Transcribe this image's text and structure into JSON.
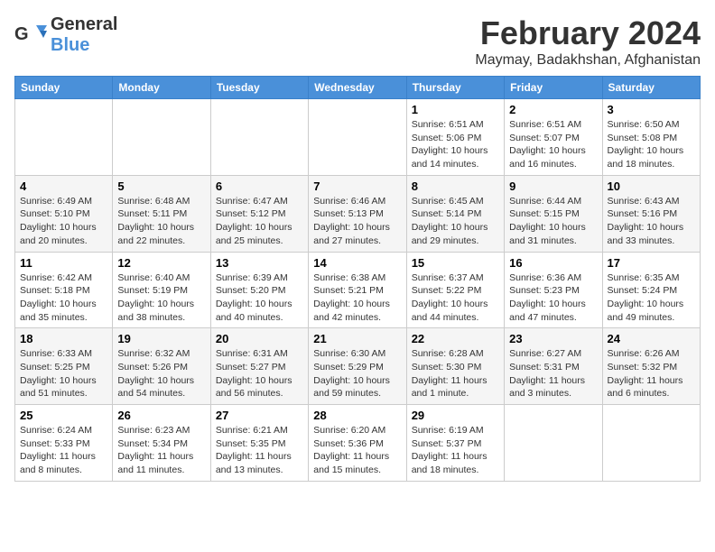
{
  "logo": {
    "general": "General",
    "blue": "Blue"
  },
  "header": {
    "month_year": "February 2024",
    "location": "Maymay, Badakhshan, Afghanistan"
  },
  "days_of_week": [
    "Sunday",
    "Monday",
    "Tuesday",
    "Wednesday",
    "Thursday",
    "Friday",
    "Saturday"
  ],
  "weeks": [
    [
      {
        "day": "",
        "info": ""
      },
      {
        "day": "",
        "info": ""
      },
      {
        "day": "",
        "info": ""
      },
      {
        "day": "",
        "info": ""
      },
      {
        "day": "1",
        "info": "Sunrise: 6:51 AM\nSunset: 5:06 PM\nDaylight: 10 hours and 14 minutes."
      },
      {
        "day": "2",
        "info": "Sunrise: 6:51 AM\nSunset: 5:07 PM\nDaylight: 10 hours and 16 minutes."
      },
      {
        "day": "3",
        "info": "Sunrise: 6:50 AM\nSunset: 5:08 PM\nDaylight: 10 hours and 18 minutes."
      }
    ],
    [
      {
        "day": "4",
        "info": "Sunrise: 6:49 AM\nSunset: 5:10 PM\nDaylight: 10 hours and 20 minutes."
      },
      {
        "day": "5",
        "info": "Sunrise: 6:48 AM\nSunset: 5:11 PM\nDaylight: 10 hours and 22 minutes."
      },
      {
        "day": "6",
        "info": "Sunrise: 6:47 AM\nSunset: 5:12 PM\nDaylight: 10 hours and 25 minutes."
      },
      {
        "day": "7",
        "info": "Sunrise: 6:46 AM\nSunset: 5:13 PM\nDaylight: 10 hours and 27 minutes."
      },
      {
        "day": "8",
        "info": "Sunrise: 6:45 AM\nSunset: 5:14 PM\nDaylight: 10 hours and 29 minutes."
      },
      {
        "day": "9",
        "info": "Sunrise: 6:44 AM\nSunset: 5:15 PM\nDaylight: 10 hours and 31 minutes."
      },
      {
        "day": "10",
        "info": "Sunrise: 6:43 AM\nSunset: 5:16 PM\nDaylight: 10 hours and 33 minutes."
      }
    ],
    [
      {
        "day": "11",
        "info": "Sunrise: 6:42 AM\nSunset: 5:18 PM\nDaylight: 10 hours and 35 minutes."
      },
      {
        "day": "12",
        "info": "Sunrise: 6:40 AM\nSunset: 5:19 PM\nDaylight: 10 hours and 38 minutes."
      },
      {
        "day": "13",
        "info": "Sunrise: 6:39 AM\nSunset: 5:20 PM\nDaylight: 10 hours and 40 minutes."
      },
      {
        "day": "14",
        "info": "Sunrise: 6:38 AM\nSunset: 5:21 PM\nDaylight: 10 hours and 42 minutes."
      },
      {
        "day": "15",
        "info": "Sunrise: 6:37 AM\nSunset: 5:22 PM\nDaylight: 10 hours and 44 minutes."
      },
      {
        "day": "16",
        "info": "Sunrise: 6:36 AM\nSunset: 5:23 PM\nDaylight: 10 hours and 47 minutes."
      },
      {
        "day": "17",
        "info": "Sunrise: 6:35 AM\nSunset: 5:24 PM\nDaylight: 10 hours and 49 minutes."
      }
    ],
    [
      {
        "day": "18",
        "info": "Sunrise: 6:33 AM\nSunset: 5:25 PM\nDaylight: 10 hours and 51 minutes."
      },
      {
        "day": "19",
        "info": "Sunrise: 6:32 AM\nSunset: 5:26 PM\nDaylight: 10 hours and 54 minutes."
      },
      {
        "day": "20",
        "info": "Sunrise: 6:31 AM\nSunset: 5:27 PM\nDaylight: 10 hours and 56 minutes."
      },
      {
        "day": "21",
        "info": "Sunrise: 6:30 AM\nSunset: 5:29 PM\nDaylight: 10 hours and 59 minutes."
      },
      {
        "day": "22",
        "info": "Sunrise: 6:28 AM\nSunset: 5:30 PM\nDaylight: 11 hours and 1 minute."
      },
      {
        "day": "23",
        "info": "Sunrise: 6:27 AM\nSunset: 5:31 PM\nDaylight: 11 hours and 3 minutes."
      },
      {
        "day": "24",
        "info": "Sunrise: 6:26 AM\nSunset: 5:32 PM\nDaylight: 11 hours and 6 minutes."
      }
    ],
    [
      {
        "day": "25",
        "info": "Sunrise: 6:24 AM\nSunset: 5:33 PM\nDaylight: 11 hours and 8 minutes."
      },
      {
        "day": "26",
        "info": "Sunrise: 6:23 AM\nSunset: 5:34 PM\nDaylight: 11 hours and 11 minutes."
      },
      {
        "day": "27",
        "info": "Sunrise: 6:21 AM\nSunset: 5:35 PM\nDaylight: 11 hours and 13 minutes."
      },
      {
        "day": "28",
        "info": "Sunrise: 6:20 AM\nSunset: 5:36 PM\nDaylight: 11 hours and 15 minutes."
      },
      {
        "day": "29",
        "info": "Sunrise: 6:19 AM\nSunset: 5:37 PM\nDaylight: 11 hours and 18 minutes."
      },
      {
        "day": "",
        "info": ""
      },
      {
        "day": "",
        "info": ""
      }
    ]
  ]
}
